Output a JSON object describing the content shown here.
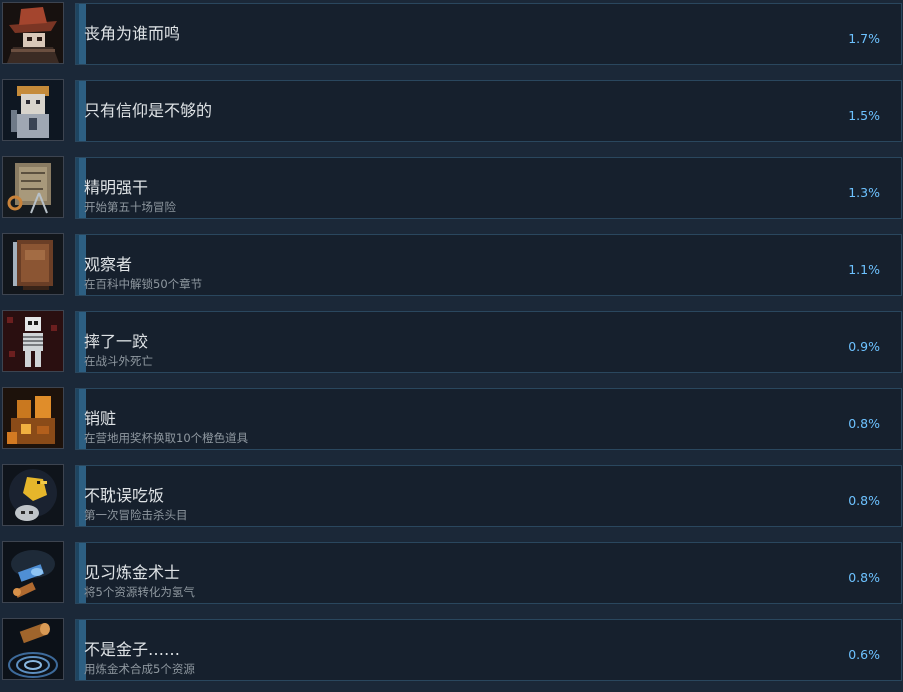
{
  "achievements": [
    {
      "title": "丧角为谁而鸣",
      "description": "",
      "percent": "1.7%",
      "icon": "hat-wizard-icon",
      "progress_fraction": 0.017
    },
    {
      "title": "只有信仰是不够的",
      "description": "",
      "percent": "1.5%",
      "icon": "nun-icon",
      "progress_fraction": 0.015
    },
    {
      "title": "精明强干",
      "description": "开始第五十场冒险",
      "percent": "1.3%",
      "icon": "map-compass-icon",
      "progress_fraction": 0.013
    },
    {
      "title": "观察者",
      "description": "在百科中解锁50个章节",
      "percent": "1.1%",
      "icon": "encyclopedia-book-icon",
      "progress_fraction": 0.011
    },
    {
      "title": "摔了一跤",
      "description": "在战斗外死亡",
      "percent": "0.9%",
      "icon": "skeleton-icon",
      "progress_fraction": 0.009
    },
    {
      "title": "销赃",
      "description": "在营地用奖杯换取10个橙色道具",
      "percent": "0.8%",
      "icon": "treasure-pile-icon",
      "progress_fraction": 0.008
    },
    {
      "title": "不耽误吃饭",
      "description": "第一次冒险击杀头目",
      "percent": "0.8%",
      "icon": "canary-skull-icon",
      "progress_fraction": 0.008
    },
    {
      "title": "见习炼金术士",
      "description": "将5个资源转化为氢气",
      "percent": "0.8%",
      "icon": "alchemy-flask-icon",
      "progress_fraction": 0.008
    },
    {
      "title": "不是金子……",
      "description": "用炼金术合成5个资源",
      "percent": "0.6%",
      "icon": "wood-log-icon",
      "progress_fraction": 0.006
    }
  ],
  "colors": {
    "background": "#1b2838",
    "card": "#16202d",
    "card_border": "#2a475e",
    "percent_text": "#6dc2ff",
    "title_text": "#dfe3e6",
    "desc_text": "#8f98a0"
  }
}
